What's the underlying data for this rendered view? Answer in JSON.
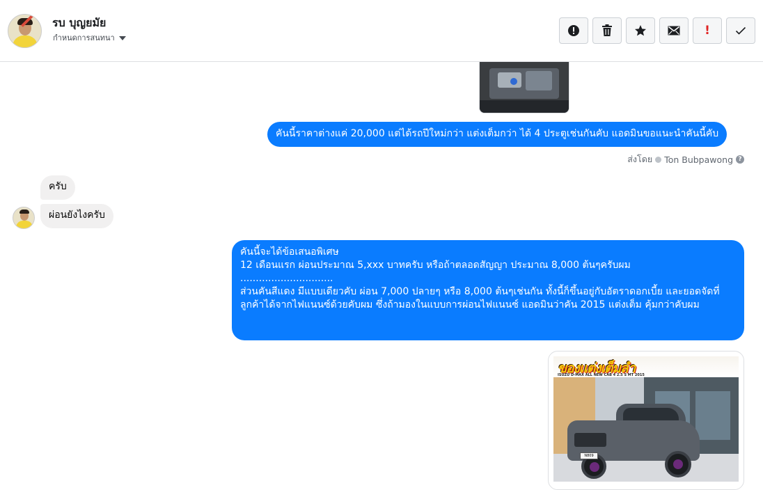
{
  "header": {
    "contact_name": "รบ บุญยมัย",
    "assign_label": "กำหนดการสนทนา"
  },
  "actions": [
    {
      "name": "report-icon"
    },
    {
      "name": "trash-icon"
    },
    {
      "name": "star-icon"
    },
    {
      "name": "mail-icon"
    },
    {
      "name": "important-icon",
      "glyph": "!"
    },
    {
      "name": "check-icon"
    }
  ],
  "messages": {
    "m1": "คันนี้ราคาต่างแค่ 20,000 แต่ได้รถปีใหม่กว่า แต่งเต็มกว่า ได้ 4 ประตูเช่นกันคับ แอดมินขอแนะนำคันนี้คับ",
    "sent_by_label": "ส่งโดย",
    "sent_by_name": "Ton Bubpawong",
    "m2": "ครับ",
    "m3": "ผ่อนยังไงครับ",
    "m4_lines": [
      "คันนี้จะได้ข้อเสนอพิเศษ",
      "12 เดือนแรก ผ่อนประมาณ 5,xxx บาทครับ หรือถ้าตลอดสัญญา ประมาณ 8,000 ต้นๆครับผม",
      "..............................",
      "ส่วนคันสีแดง มีแบบเดียวคับ ผ่อน 7,000 ปลายๆ หรือ 8,000 ต้นๆเช่นกัน ทั้งนี้ก็ขึ้นอยู่กับอัตราดอกเบี้ย และยอดจัดที่ ลูกค้าได้จากไฟแนนซ์ด้วยคับผม ซึ่งถ้ามองในแบบการผ่อนไฟแนนซ์ แอดมินว่าคัน 2015 แต่งเต็ม คุ้มกว่าคับผม"
    ]
  },
  "car_image": {
    "banner_title": "ของแต่งเต็มลำ",
    "banner_sub": "ISUZU D-MAX ALL NEW CAB 4 2.5 S MT 2015",
    "plate": "N809"
  },
  "colors": {
    "outgoing_bubble": "#0a7cff",
    "incoming_bubble": "#f1f0f0",
    "important_red": "#e02424"
  }
}
